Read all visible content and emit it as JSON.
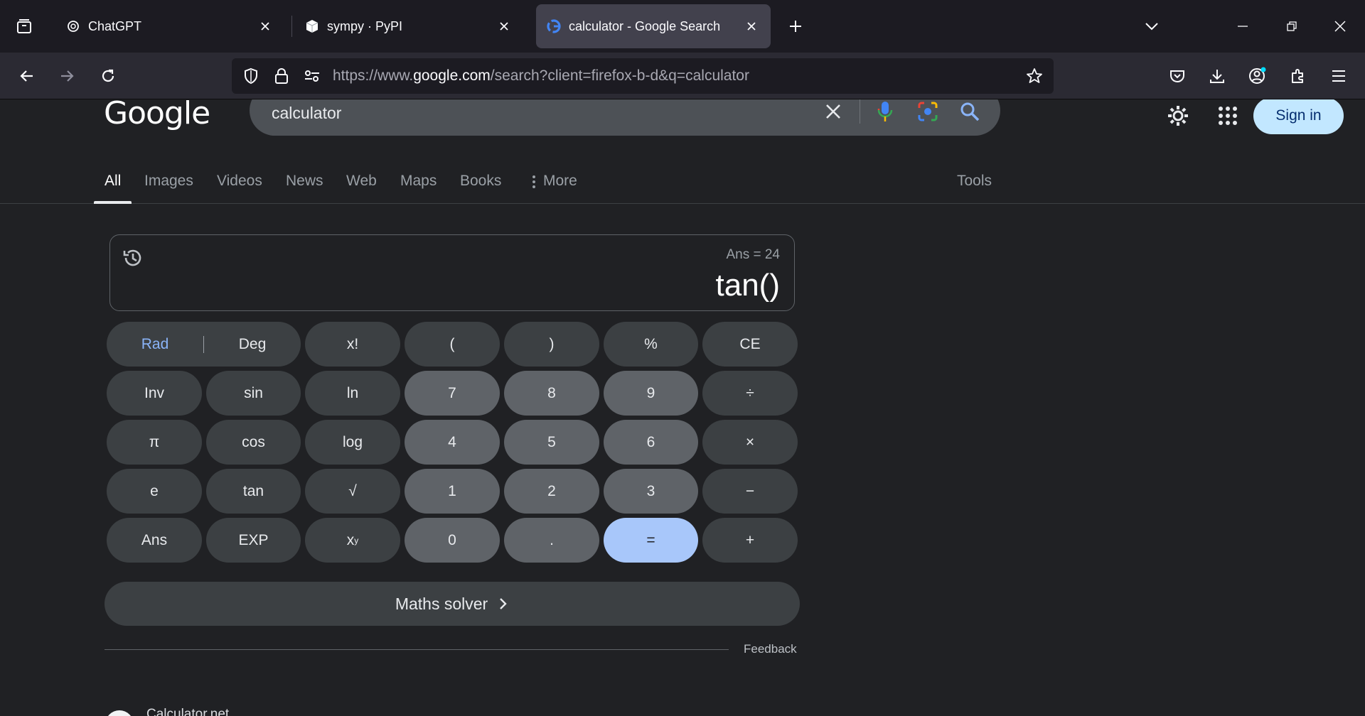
{
  "browser": {
    "tabs": [
      {
        "title": "ChatGPT",
        "icon": "chatgpt-icon",
        "active": false
      },
      {
        "title": "sympy · PyPI",
        "icon": "pypi-icon",
        "active": false
      },
      {
        "title": "calculator - Google Search",
        "icon": "google-g-icon",
        "active": true
      }
    ],
    "url": {
      "scheme": "https://www.",
      "host": "google.com",
      "path": "/search?client=firefox-b-d&q=calculator"
    }
  },
  "google": {
    "logo": "Google",
    "query": "calculator",
    "signin_label": "Sign in",
    "tabs": [
      "All",
      "Images",
      "Videos",
      "News",
      "Web",
      "Maps",
      "Books",
      "More"
    ],
    "tools_label": "Tools"
  },
  "calculator": {
    "history_ans": "Ans = 24",
    "expression": "tan()",
    "keys": {
      "rad": "Rad",
      "deg": "Deg",
      "fact": "x!",
      "lparen": "(",
      "rparen": ")",
      "percent": "%",
      "ce": "CE",
      "inv": "Inv",
      "sin": "sin",
      "ln": "ln",
      "d7": "7",
      "d8": "8",
      "d9": "9",
      "divide": "÷",
      "pi": "π",
      "cos": "cos",
      "log": "log",
      "d4": "4",
      "d5": "5",
      "d6": "6",
      "multiply": "×",
      "e": "e",
      "tan": "tan",
      "sqrt": "√",
      "d1": "1",
      "d2": "2",
      "d3": "3",
      "minus": "−",
      "ans": "Ans",
      "exp": "EXP",
      "pow_base": "x",
      "pow_sup": "y",
      "d0": "0",
      "dot": ".",
      "equals": "=",
      "plus": "+"
    },
    "solver_label": "Maths solver",
    "feedback_label": "Feedback"
  },
  "result": {
    "site_name": "Calculator.net"
  },
  "colors": {
    "page_bg": "#202124",
    "fn_key": "#3c4043",
    "num_key": "#5f6368",
    "equals_key": "#a8c7fa",
    "rad_active": "#8ab4f8",
    "signin_bg": "#c2e7ff"
  }
}
